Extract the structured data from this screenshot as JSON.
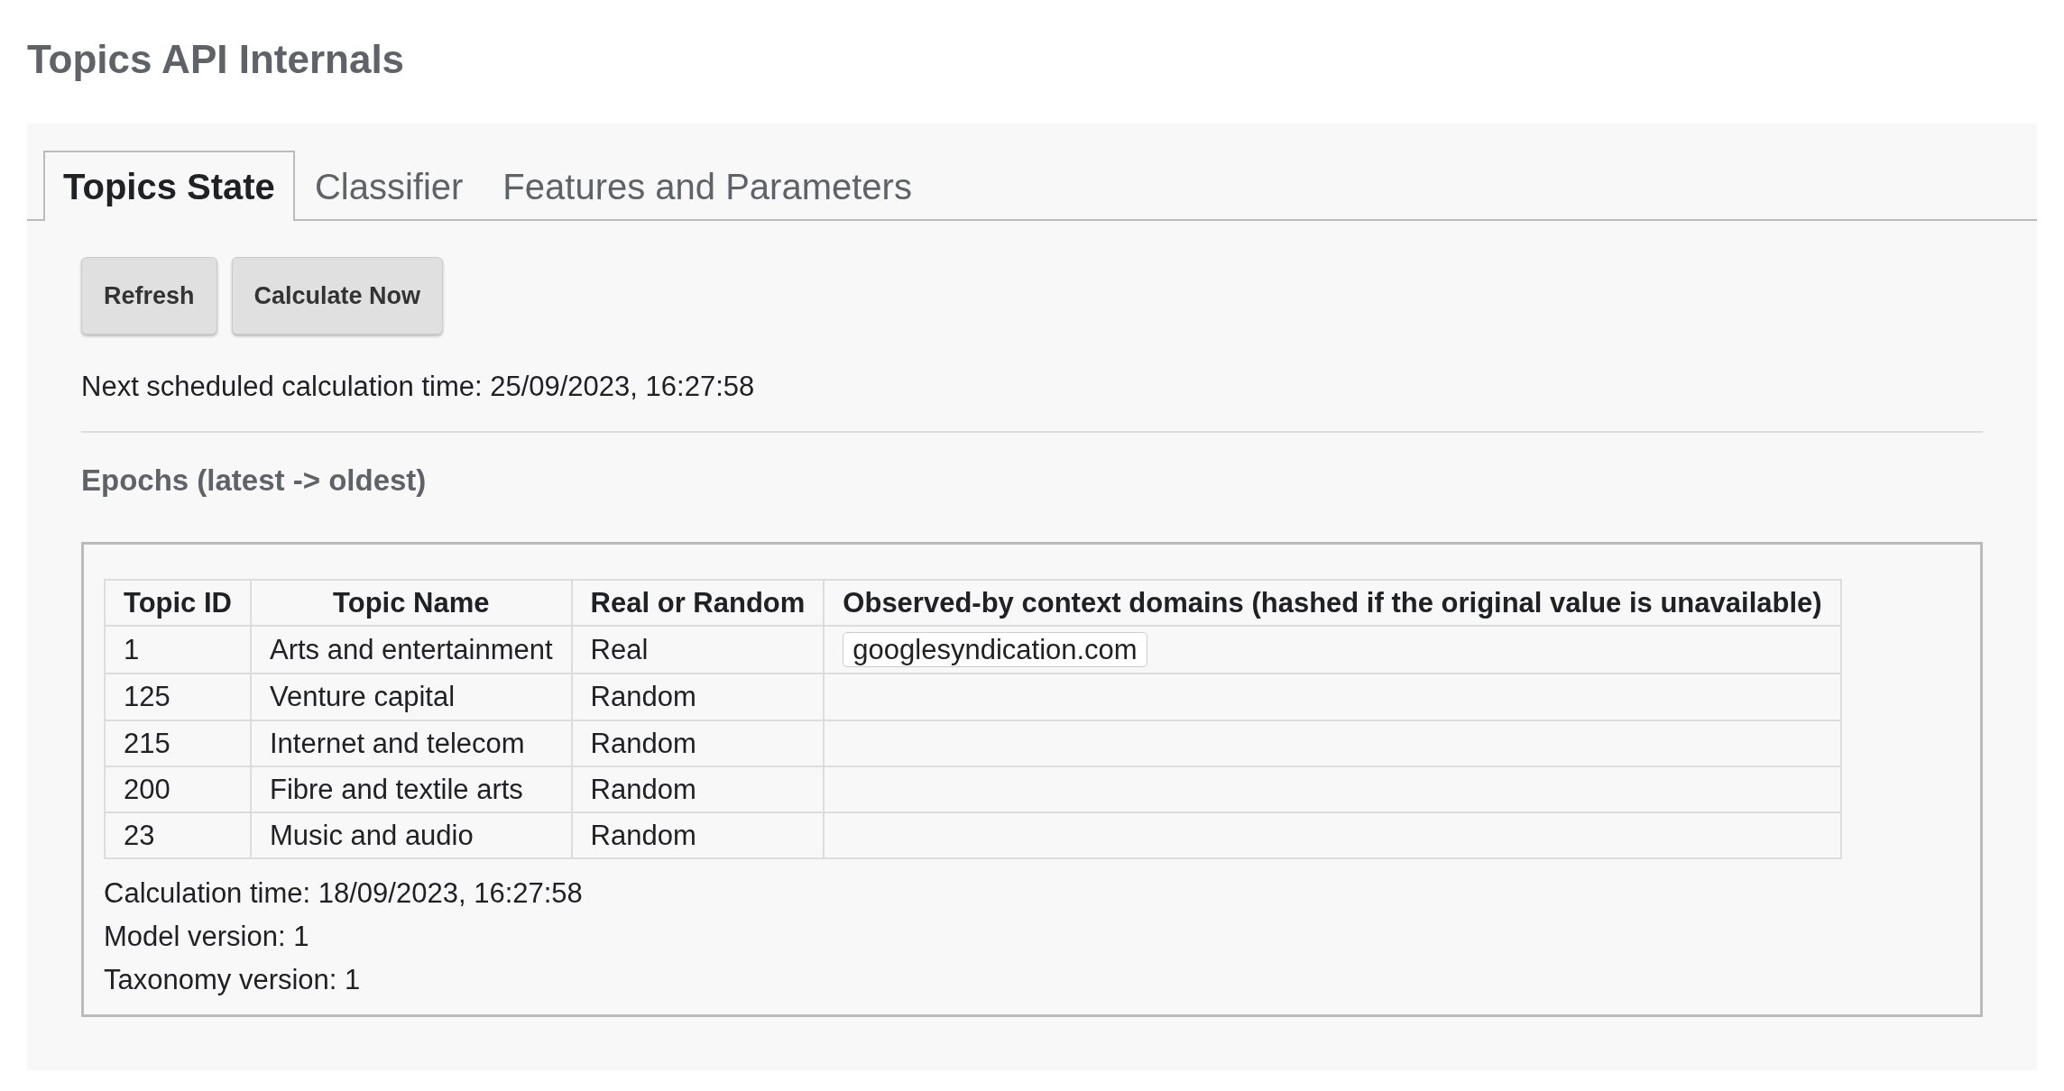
{
  "page_title": "Topics API Internals",
  "tabs": [
    {
      "label": "Topics State",
      "selected": true
    },
    {
      "label": "Classifier",
      "selected": false
    },
    {
      "label": "Features and Parameters",
      "selected": false
    }
  ],
  "buttons": [
    "Refresh",
    "Calculate Now"
  ],
  "next_calculation": "Next scheduled calculation time: 25/09/2023, 16:27:58",
  "epochs_heading": "Epochs (latest -> oldest)",
  "epochs": [
    {
      "table": {
        "columns": [
          "Topic ID",
          "Topic Name",
          "Real or Random",
          "Observed-by context domains (hashed if the original value is unavailable)"
        ],
        "rows": [
          {
            "id": "1",
            "name": "Arts and entertainment",
            "real_or_random": "Real",
            "domains": [
              "googlesyndication.com"
            ]
          },
          {
            "id": "125",
            "name": "Venture capital",
            "real_or_random": "Random",
            "domains": []
          },
          {
            "id": "215",
            "name": "Internet and telecom",
            "real_or_random": "Random",
            "domains": []
          },
          {
            "id": "200",
            "name": "Fibre and textile arts",
            "real_or_random": "Random",
            "domains": []
          },
          {
            "id": "23",
            "name": "Music and audio",
            "real_or_random": "Random",
            "domains": []
          }
        ]
      },
      "details": [
        "Calculation time: 18/09/2023, 16:27:58",
        "Model version: 1",
        "Taxonomy version: 1"
      ]
    }
  ]
}
